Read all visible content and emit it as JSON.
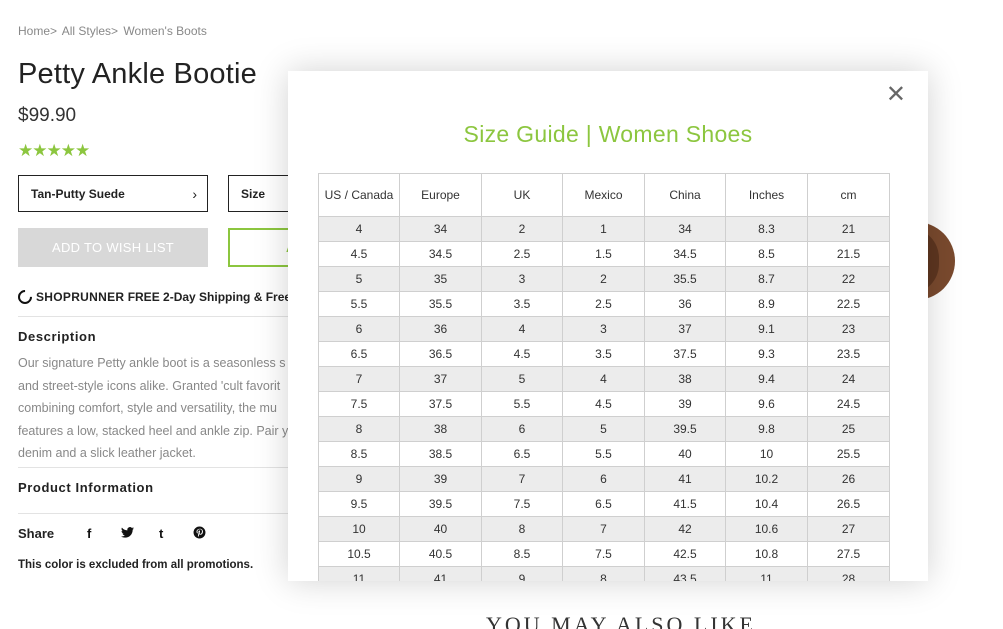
{
  "breadcrumb": [
    "Home>",
    "All Styles>",
    "Women's Boots"
  ],
  "product": {
    "title": "Petty Ankle Bootie",
    "price": "$99.90",
    "rating_stars": "★★★★★",
    "color_select": "Tan-Putty Suede",
    "size_select": "Size",
    "wish_button": "ADD TO WISH LIST",
    "add_button": "A",
    "shoprunner_brand": "SHOPRUNNER",
    "shoprunner_text": "FREE 2-Day Shipping & Free",
    "description_heading": "Description",
    "description_lines": [
      "Our signature Petty ankle boot is a seasonless s",
      "and street-style icons alike. Granted 'cult favorit",
      "combining comfort, style and versatility, the mu",
      "features a low, stacked heel and ankle zip. Pair y",
      "denim and a slick leather jacket."
    ],
    "product_info_heading": "Product Information",
    "share_label": "Share",
    "share_icons": {
      "facebook": "f",
      "twitter": "🐦",
      "tumblr": "t",
      "pinterest": "℗"
    },
    "promo_note": "This color is excluded from all promotions.",
    "also_like": "YOU MAY ALSO LIKE"
  },
  "modal": {
    "title": "Size Guide | Women Shoes",
    "close_glyph": "✕",
    "columns": [
      "US / Canada",
      "Europe",
      "UK",
      "Mexico",
      "China",
      "Inches",
      "cm"
    ],
    "rows": [
      [
        "4",
        "34",
        "2",
        "1",
        "34",
        "8.3",
        "21"
      ],
      [
        "4.5",
        "34.5",
        "2.5",
        "1.5",
        "34.5",
        "8.5",
        "21.5"
      ],
      [
        "5",
        "35",
        "3",
        "2",
        "35.5",
        "8.7",
        "22"
      ],
      [
        "5.5",
        "35.5",
        "3.5",
        "2.5",
        "36",
        "8.9",
        "22.5"
      ],
      [
        "6",
        "36",
        "4",
        "3",
        "37",
        "9.1",
        "23"
      ],
      [
        "6.5",
        "36.5",
        "4.5",
        "3.5",
        "37.5",
        "9.3",
        "23.5"
      ],
      [
        "7",
        "37",
        "5",
        "4",
        "38",
        "9.4",
        "24"
      ],
      [
        "7.5",
        "37.5",
        "5.5",
        "4.5",
        "39",
        "9.6",
        "24.5"
      ],
      [
        "8",
        "38",
        "6",
        "5",
        "39.5",
        "9.8",
        "25"
      ],
      [
        "8.5",
        "38.5",
        "6.5",
        "5.5",
        "40",
        "10",
        "25.5"
      ],
      [
        "9",
        "39",
        "7",
        "6",
        "41",
        "10.2",
        "26"
      ],
      [
        "9.5",
        "39.5",
        "7.5",
        "6.5",
        "41.5",
        "10.4",
        "26.5"
      ],
      [
        "10",
        "40",
        "8",
        "7",
        "42",
        "10.6",
        "27"
      ],
      [
        "10.5",
        "40.5",
        "8.5",
        "7.5",
        "42.5",
        "10.8",
        "27.5"
      ],
      [
        "11",
        "41",
        "9",
        "8",
        "43.5",
        "11",
        "28"
      ]
    ]
  },
  "colors": {
    "accent": "#8cc63f",
    "wish_bg": "#d8d8d8"
  }
}
